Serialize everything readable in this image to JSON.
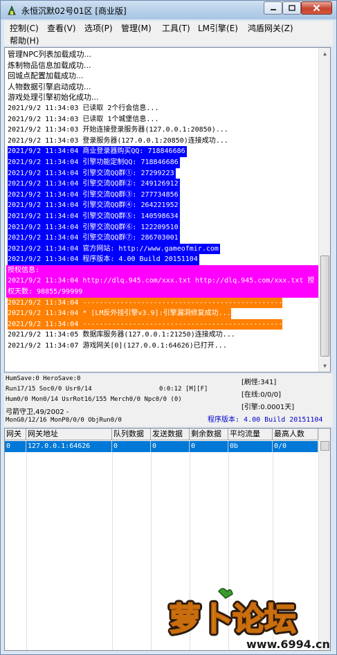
{
  "window": {
    "title": "永恒沉默02号01区 [商业版]"
  },
  "menu": [
    {
      "label": "控制(C)"
    },
    {
      "label": "查看(V)"
    },
    {
      "label": "选项(P)"
    },
    {
      "label": "管理(M)"
    },
    {
      "label": "工具(T)"
    },
    {
      "label": "LM引擎(E)"
    },
    {
      "label": "鸿盾网关(Z)"
    },
    {
      "label": "帮助(H)"
    }
  ],
  "log": [
    {
      "text": "管理NPC列表加载成功...",
      "style": "cn"
    },
    {
      "text": "炼制物品信息加载成功...",
      "style": "cn"
    },
    {
      "text": "回城点配置加载成功...",
      "style": "cn"
    },
    {
      "text": "人物数据引擎启动成功...",
      "style": "cn"
    },
    {
      "text": "游戏处理引擎初始化成功...",
      "style": "cn"
    },
    {
      "text": "2021/9/2 11:34:03 已读取 2个行会信息...",
      "style": "plain"
    },
    {
      "text": "2021/9/2 11:34:03 已读取 1个城堡信息...",
      "style": "plain"
    },
    {
      "text": "2021/9/2 11:34:03 开始连接登录服务器(127.0.0.1:20850)...",
      "style": "plain"
    },
    {
      "text": "2021/9/2 11:34:03 登录服务器(127.0.0.1:20850)连接成功...",
      "style": "plain"
    },
    {
      "text": "2021/9/2 11:34:04 商业登录器购买QQ: 718846686",
      "style": "blue"
    },
    {
      "text": "2021/9/2 11:34:04 引擎功能定制QQ: 718846686",
      "style": "blue"
    },
    {
      "text": "2021/9/2 11:34:04 引擎交流QQ群①: 27299223",
      "style": "blue"
    },
    {
      "text": "2021/9/2 11:34:04 引擎交流QQ群②: 249126912",
      "style": "blue"
    },
    {
      "text": "2021/9/2 11:34:04 引擎交流QQ群③: 277734856",
      "style": "blue"
    },
    {
      "text": "2021/9/2 11:34:04 引擎交流QQ群④: 264221952",
      "style": "blue"
    },
    {
      "text": "2021/9/2 11:34:04 引擎交流QQ群⑤: 140598634",
      "style": "blue"
    },
    {
      "text": "2021/9/2 11:34:04 引擎交流QQ群⑥: 122209510",
      "style": "blue"
    },
    {
      "text": "2021/9/2 11:34:04 引擎交流QQ群⑦: 286703001",
      "style": "blue"
    },
    {
      "text": "2021/9/2 11:34:04 官方网站: http://www.gameofmir.com",
      "style": "blue"
    },
    {
      "text": "2021/9/2 11:34:04 程序版本: 4.00 Build 20151104",
      "style": "blue"
    },
    {
      "text": "授权信息:",
      "style": "mag"
    },
    {
      "text": "2021/9/2 11:34:04 http://dlq.945.com/xxx.txt http://dlq.945.com/xxx.txt 授",
      "style": "mag"
    },
    {
      "text": "权天数: 98855/99999",
      "style": "mag"
    },
    {
      "text": "2021/9/2 11:34:04 ------------------------------------------------",
      "style": "orange"
    },
    {
      "text": "2021/9/2 11:34:04 * [LM反外挂引擎v3.9]:引擎漏洞修复成功...",
      "style": "orange"
    },
    {
      "text": "2021/9/2 11:34:04 ------------------------------------------------",
      "style": "orange"
    },
    {
      "text": "2021/9/2 11:34:05 数据库服务器(127.0.0.1:21250)连接成功...",
      "style": "plain"
    },
    {
      "text": "2021/9/2 11:34:07 游戏网关[0](127.0.0.1:64626)已打开...",
      "style": "plain"
    }
  ],
  "status": {
    "line1": "HumSave:0 HeroSave:0",
    "line2": "Run17/15 Soc0/0 Usr0/14",
    "time": "0:0:12 [M][F]",
    "line3": "Hum0/0 Mon0/14 UsrRot16/155 Merch0/0 Npc0/0 (0)",
    "line4": "弓箭守卫,49/2002 -",
    "line5": "MonG0/12/16 MonP0/0/0 ObjRun0/0",
    "refresh": "[刷怪:341]",
    "online": "[在线:0/0/0]",
    "engine": "[引擎:0.0001天]",
    "version": "程序版本: 4.00 Build 20151104"
  },
  "grid": {
    "headers": [
      "网关",
      "网关地址",
      "队列数据",
      "发送数据",
      "剩余数据",
      "平均流量",
      "最高人数"
    ],
    "rows": [
      [
        "0",
        "127.0.0.1:64626",
        "0",
        "0",
        "0",
        "0b",
        "0/0"
      ]
    ]
  },
  "watermark": {
    "logo_text": "萝卜论坛",
    "url": "www.6994.cn"
  },
  "colors": {
    "highlight_blue": "#0000ff",
    "highlight_magenta": "#ff00ff",
    "highlight_orange": "#ff7f00",
    "selection": "#0078d7",
    "version_text": "#0000cc"
  }
}
